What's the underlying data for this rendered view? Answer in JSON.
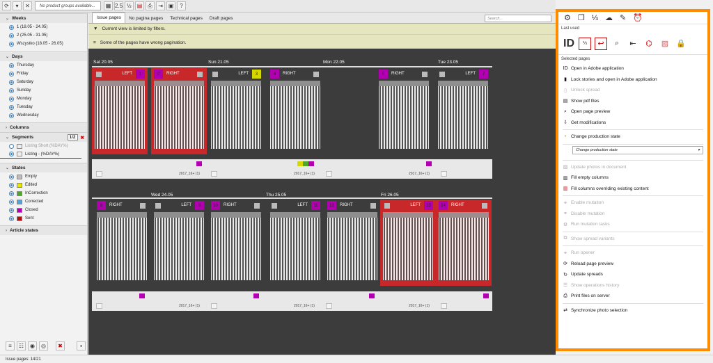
{
  "toolbar": {
    "product_groups": "No product groups available...",
    "zoom": "2.5"
  },
  "sidebar": {
    "weeks_title": "Weeks",
    "weeks": [
      "1 (18.05 - 24.05)",
      "2 (25.05 - 31.05)",
      "Wszystko (18.05 - 26.05)"
    ],
    "days_title": "Days",
    "days": [
      "Thursday",
      "Friday",
      "Saturday",
      "Sunday",
      "Monday",
      "Tuesday",
      "Wednesday"
    ],
    "columns_title": "Columns",
    "segments_title": "Segments",
    "segments_count": "1/2",
    "segments": [
      "Listing Short (%DAY%)",
      "Listing - (%DAY%)"
    ],
    "states_title": "States",
    "states": [
      {
        "label": "Empty",
        "color": "#bdbdbd"
      },
      {
        "label": "Edited",
        "color": "#e6e600"
      },
      {
        "label": "InCorrection",
        "color": "#52a52a"
      },
      {
        "label": "Corrected",
        "color": "#5aa0d0"
      },
      {
        "label": "Closed",
        "color": "#b000b0"
      },
      {
        "label": "Sent",
        "color": "#b01010"
      }
    ],
    "article_states_title": "Article states"
  },
  "tabs": [
    "Issue pages",
    "No pagina pages",
    "Technical pages",
    "Draft pages"
  ],
  "search_placeholder": "Search...",
  "banners": [
    "Current view is limited by filters.",
    "Some of the pages have wrong pagination."
  ],
  "days_row1": [
    "Sat 20.05",
    "Sun 21.05",
    "Mon 22.05",
    "Tue 23.05"
  ],
  "days_row2": [
    "Wed 24.05",
    "Thu 25.05",
    "Fri 26.05"
  ],
  "row1_pages": [
    {
      "num": "1",
      "side": "LEFT",
      "color": "#c8282a"
    },
    {
      "num": "2",
      "side": "RIGHT",
      "color": "#c8282a"
    },
    {
      "num": "3",
      "side": "LEFT",
      "color": "#3c3c3c"
    },
    {
      "num": "4",
      "side": "RIGHT",
      "color": "#3c3c3c"
    },
    {
      "num": "6",
      "side": "RIGHT",
      "color": "#3c3c3c"
    },
    {
      "num": "7",
      "side": "LEFT",
      "color": "#3c3c3c"
    }
  ],
  "row2_pages": [
    {
      "num": "8",
      "side": "RIGHT",
      "color": "#3c3c3c"
    },
    {
      "num": "9",
      "side": "LEFT",
      "color": "#3c3c3c"
    },
    {
      "num": "10",
      "side": "RIGHT",
      "color": "#3c3c3c"
    },
    {
      "num": "11",
      "side": "LEFT",
      "color": "#3c3c3c"
    },
    {
      "num": "12",
      "side": "RIGHT",
      "color": "#3c3c3c"
    },
    {
      "num": "13",
      "side": "LEFT",
      "color": "#c8282a"
    },
    {
      "num": "14",
      "side": "RIGHT",
      "color": "#c8282a"
    }
  ],
  "strip_label": "2017_16+ (1)",
  "strip_markers_row1": [
    "3",
    "3",
    "1"
  ],
  "right_panel": {
    "last_used": "Last used",
    "selected_pages": "Selected pages",
    "actions": [
      {
        "label": "Open in Adobe application",
        "enabled": true,
        "icon": "indesign-icon"
      },
      {
        "label": "Lock stories and open in Adobe application",
        "enabled": true,
        "icon": "lock-icon"
      },
      {
        "label": "Unlock spread",
        "enabled": false,
        "icon": "unlock-icon"
      },
      {
        "label": "Show pdf files",
        "enabled": true,
        "icon": "pdf-icon"
      },
      {
        "label": "Open page preview",
        "enabled": true,
        "icon": "search-icon"
      },
      {
        "label": "Get modifications",
        "enabled": true,
        "icon": "modifications-icon",
        "sep": true
      },
      {
        "label": "Change production state",
        "enabled": true,
        "icon": "state-icon",
        "sep": true
      }
    ],
    "state_select": "Change production state",
    "actions2": [
      {
        "label": "Update photos in document",
        "enabled": false,
        "icon": "photo-icon"
      },
      {
        "label": "Fill empty columns",
        "enabled": true,
        "icon": "fill-icon"
      },
      {
        "label": "Fill columns overriding existing content",
        "enabled": true,
        "icon": "fill-override-icon",
        "sep": true
      },
      {
        "label": "Enable mutation",
        "enabled": false,
        "icon": "mutation-icon"
      },
      {
        "label": "Disable mutation",
        "enabled": false,
        "icon": "mutation-off-icon"
      },
      {
        "label": "Run mutation tasks",
        "enabled": false,
        "icon": "tasks-icon",
        "sep": true
      },
      {
        "label": "Show spread variants",
        "enabled": false,
        "icon": "variants-icon",
        "sep": true
      },
      {
        "label": "Run opener",
        "enabled": false,
        "icon": "opener-icon"
      },
      {
        "label": "Reload page preview",
        "enabled": true,
        "icon": "reload-icon"
      },
      {
        "label": "Update spreads",
        "enabled": true,
        "icon": "update-icon"
      },
      {
        "label": "Show operations history",
        "enabled": false,
        "icon": "history-icon"
      },
      {
        "label": "Print files on server",
        "enabled": true,
        "icon": "print-icon",
        "sep": true
      },
      {
        "label": "Synchronize photo selection",
        "enabled": true,
        "icon": "sync-icon"
      }
    ]
  },
  "status": "Issue pages: 14/21"
}
